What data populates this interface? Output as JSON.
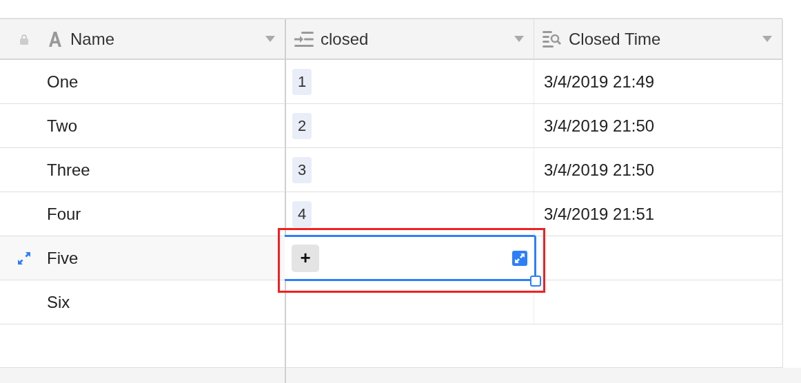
{
  "table": {
    "columns": [
      {
        "label": "Name",
        "kind": "text"
      },
      {
        "label": "closed",
        "kind": "count"
      },
      {
        "label": "Closed Time",
        "kind": "lookup"
      }
    ],
    "rows": [
      {
        "name": "One",
        "closed": "1",
        "closed_time": "3/4/2019 21:49",
        "selected": false
      },
      {
        "name": "Two",
        "closed": "2",
        "closed_time": "3/4/2019 21:50",
        "selected": false
      },
      {
        "name": "Three",
        "closed": "3",
        "closed_time": "3/4/2019 21:50",
        "selected": false
      },
      {
        "name": "Four",
        "closed": "4",
        "closed_time": "3/4/2019 21:51",
        "selected": false
      },
      {
        "name": "Five",
        "selected": true
      },
      {
        "name": "Six",
        "selected": false
      }
    ],
    "editor": {
      "add_label": "+"
    }
  }
}
